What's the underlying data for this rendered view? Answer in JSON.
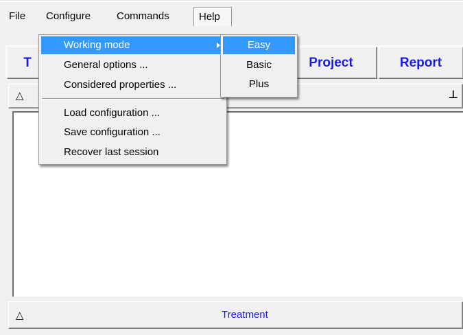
{
  "menubar": {
    "items": [
      {
        "label": "File"
      },
      {
        "label": "Configure"
      },
      {
        "label": "Commands"
      },
      {
        "label": "Help"
      }
    ]
  },
  "tabs": {
    "first_partial": "T",
    "project": "Project",
    "report": "Report"
  },
  "panel": {
    "top_toggle_glyph": "△",
    "pin_glyph": "⊥",
    "bottom_toggle_glyph": "△",
    "bottom_title": "Treatment"
  },
  "configure_menu": {
    "items": [
      {
        "label": "Working mode",
        "highlighted": true,
        "has_submenu": true
      },
      {
        "label": "General options ..."
      },
      {
        "label": "Considered properties ..."
      },
      {
        "label": "Load configuration ..."
      },
      {
        "label": "Save configuration ..."
      },
      {
        "label": "Recover last session"
      }
    ]
  },
  "working_mode_submenu": {
    "items": [
      {
        "label": "Easy",
        "highlighted": true
      },
      {
        "label": "Basic"
      },
      {
        "label": "Plus"
      }
    ]
  },
  "colors": {
    "highlight": "#3399ff",
    "accent_text": "#1a1ae6",
    "background": "#f0f0f0"
  }
}
